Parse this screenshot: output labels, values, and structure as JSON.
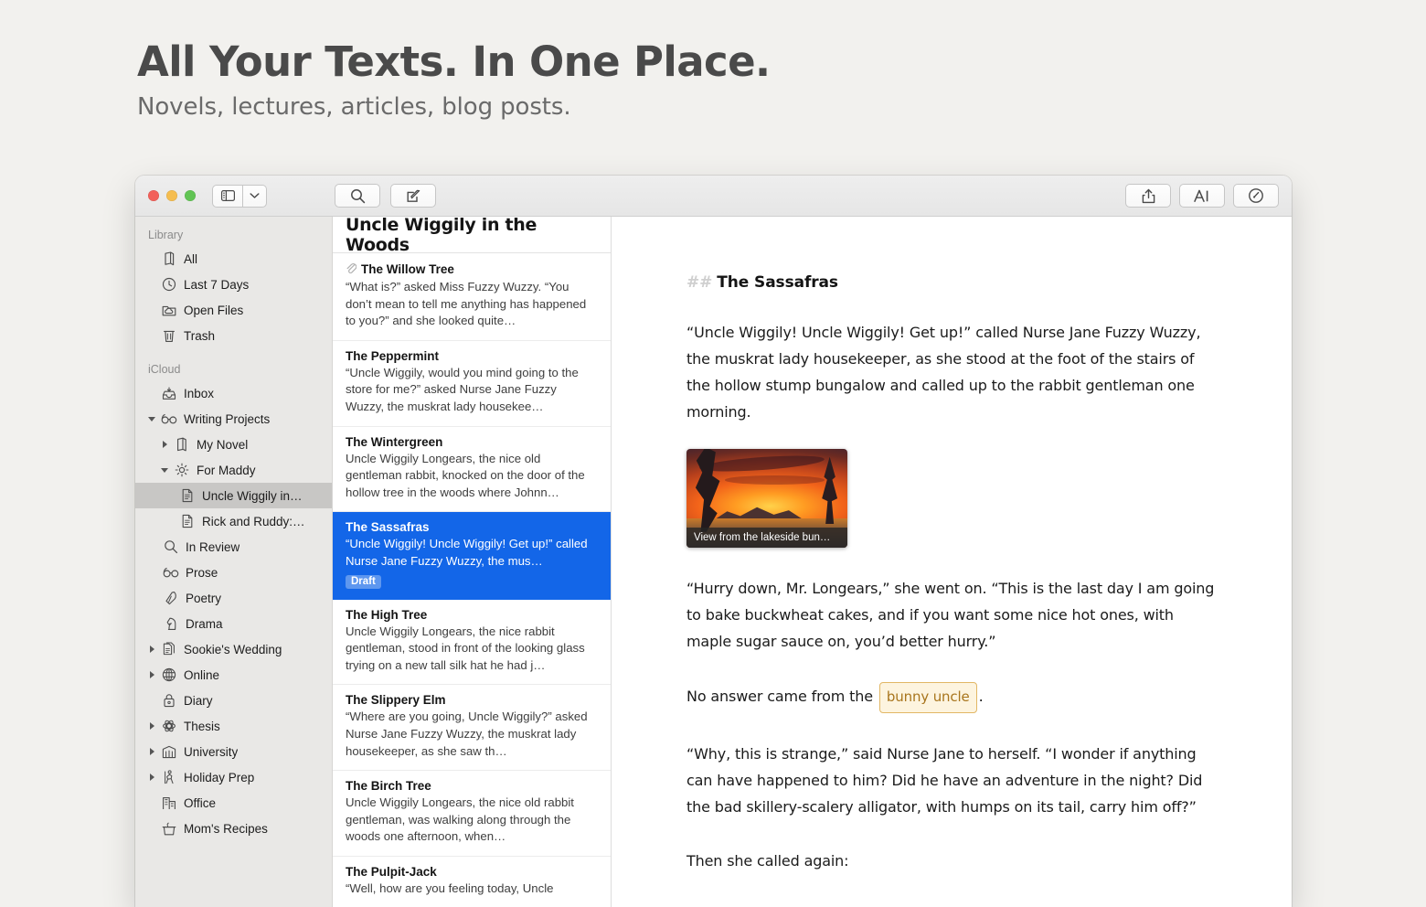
{
  "promo": {
    "title": "All Your Texts. In One Place.",
    "subtitle": "Novels, lectures, articles, blog posts."
  },
  "colors": {
    "accent_selection": "#1366e8",
    "sidebar_bg": "#e9e8e6",
    "page_bg": "#f2f1ee",
    "tag_text": "#a8751d",
    "tag_bg": "#fdf4df"
  },
  "toolbar": {
    "sidebar_toggle": "sidebar-toggle",
    "sidebar_dropdown": "chevron-down",
    "search": "search",
    "compose": "compose",
    "share": "share",
    "format": "format-text",
    "info": "info-dial"
  },
  "sidebar": {
    "sections": [
      {
        "label": "Library",
        "items": [
          {
            "label": "All",
            "icon": "books-icon",
            "indent": 1,
            "twisty": "",
            "selected": false
          },
          {
            "label": "Last 7 Days",
            "icon": "clock-icon",
            "indent": 1,
            "twisty": "",
            "selected": false
          },
          {
            "label": "Open Files",
            "icon": "folder-cloud-icon",
            "indent": 1,
            "twisty": "",
            "selected": false
          },
          {
            "label": "Trash",
            "icon": "trash-icon",
            "indent": 1,
            "twisty": "",
            "selected": false
          }
        ]
      },
      {
        "label": "iCloud",
        "items": [
          {
            "label": "Inbox",
            "icon": "inbox-icon",
            "indent": 1,
            "twisty": "",
            "selected": false
          },
          {
            "label": "Writing Projects",
            "icon": "glasses-icon",
            "indent": 0,
            "twisty": "down",
            "selected": false
          },
          {
            "label": "My Novel",
            "icon": "book-icon",
            "indent": 1,
            "twisty": "right",
            "selected": false
          },
          {
            "label": "For Maddy",
            "icon": "sun-icon",
            "indent": 1,
            "twisty": "down",
            "selected": false
          },
          {
            "label": "Uncle Wiggily in…",
            "icon": "document-icon",
            "indent": 3,
            "twisty": "",
            "selected": true
          },
          {
            "label": "Rick and Ruddy:…",
            "icon": "document-icon",
            "indent": 3,
            "twisty": "",
            "selected": false
          },
          {
            "label": "In Review",
            "icon": "magnifier-icon",
            "indent": 2,
            "twisty": "",
            "selected": false
          },
          {
            "label": "Prose",
            "icon": "glasses-icon",
            "indent": 2,
            "twisty": "",
            "selected": false
          },
          {
            "label": "Poetry",
            "icon": "pen-nib-icon",
            "indent": 2,
            "twisty": "",
            "selected": false
          },
          {
            "label": "Drama",
            "icon": "chess-knight-icon",
            "indent": 2,
            "twisty": "",
            "selected": false
          },
          {
            "label": "Sookie's Wedding",
            "icon": "documents-icon",
            "indent": 0,
            "twisty": "right",
            "selected": false
          },
          {
            "label": "Online",
            "icon": "globe-icon",
            "indent": 0,
            "twisty": "right",
            "selected": false
          },
          {
            "label": "Diary",
            "icon": "lock-icon",
            "indent": 1,
            "twisty": "",
            "selected": false
          },
          {
            "label": "Thesis",
            "icon": "atom-icon",
            "indent": 0,
            "twisty": "right",
            "selected": false
          },
          {
            "label": "University",
            "icon": "library-icon",
            "indent": 0,
            "twisty": "right",
            "selected": false
          },
          {
            "label": "Holiday Prep",
            "icon": "hiker-icon",
            "indent": 0,
            "twisty": "right",
            "selected": false
          },
          {
            "label": "Office",
            "icon": "building-icon",
            "indent": 1,
            "twisty": "",
            "selected": false
          },
          {
            "label": "Mom's Recipes",
            "icon": "pot-icon",
            "indent": 1,
            "twisty": "",
            "selected": false
          }
        ]
      }
    ]
  },
  "notelist": {
    "header": "Uncle Wiggily in the Woods",
    "notes": [
      {
        "title": "The Willow Tree",
        "preview": "“What is?” asked Miss Fuzzy Wuzzy. “You don’t mean to tell me anything has happened to you?” and she looked quite…",
        "attachment": true,
        "selected": false,
        "badge": ""
      },
      {
        "title": "The Peppermint",
        "preview": "“Uncle Wiggily, would you mind going to the store for me?” asked Nurse Jane Fuzzy Wuzzy, the muskrat lady housekee…",
        "attachment": false,
        "selected": false,
        "badge": ""
      },
      {
        "title": "The Wintergreen",
        "preview": "Uncle Wiggily Longears, the nice old gentleman rabbit, knocked on the door of the hollow tree in the woods where Johnn…",
        "attachment": false,
        "selected": false,
        "badge": ""
      },
      {
        "title": "The Sassafras",
        "preview": "“Uncle Wiggily! Uncle Wiggily! Get up!” called Nurse Jane Fuzzy Wuzzy, the mus…",
        "attachment": false,
        "selected": true,
        "badge": "Draft"
      },
      {
        "title": "The High Tree",
        "preview": "Uncle Wiggily Longears, the nice rabbit gentleman, stood in front of the looking glass trying on a new tall silk hat he had j…",
        "attachment": false,
        "selected": false,
        "badge": ""
      },
      {
        "title": "The Slippery Elm",
        "preview": "“Where are you going, Uncle Wiggily?” asked Nurse Jane Fuzzy Wuzzy, the muskrat lady housekeeper, as she saw th…",
        "attachment": false,
        "selected": false,
        "badge": ""
      },
      {
        "title": "The Birch Tree",
        "preview": "Uncle Wiggily Longears, the nice old rabbit gentleman, was walking along through the woods one afternoon, when…",
        "attachment": false,
        "selected": false,
        "badge": ""
      },
      {
        "title": "The Pulpit-Jack",
        "preview": "“Well, how are you feeling today, Uncle",
        "attachment": false,
        "selected": false,
        "badge": ""
      }
    ]
  },
  "editor": {
    "heading_marker": "##",
    "heading": "The Sassafras",
    "paragraph_1": "“Uncle Wiggily! Uncle Wiggily! Get up!” called Nurse Jane Fuzzy Wuzzy, the muskrat lady housekeeper, as she stood at the foot of the stairs of the hollow stump bungalow and called up to the rabbit gentleman one morning.",
    "image_caption": "View from the lakeside bun…",
    "paragraph_2": "“Hurry down, Mr. Longears,” she went on. “This is the last day I am going to bake buckwheat cakes, and if you want some nice hot ones, with maple sugar sauce on, you’d better hurry.”",
    "paragraph_3_before": "No answer came from the ",
    "paragraph_3_tag": "bunny uncle",
    "paragraph_3_after": ".",
    "paragraph_4": "“Why, this is strange,” said Nurse Jane to herself. “I wonder if anything can have happened to him? Did he have an adventure in the night? Did the bad skillery-scalery alligator, with humps on its tail, carry him off?”",
    "paragraph_5": "Then she called again:"
  }
}
